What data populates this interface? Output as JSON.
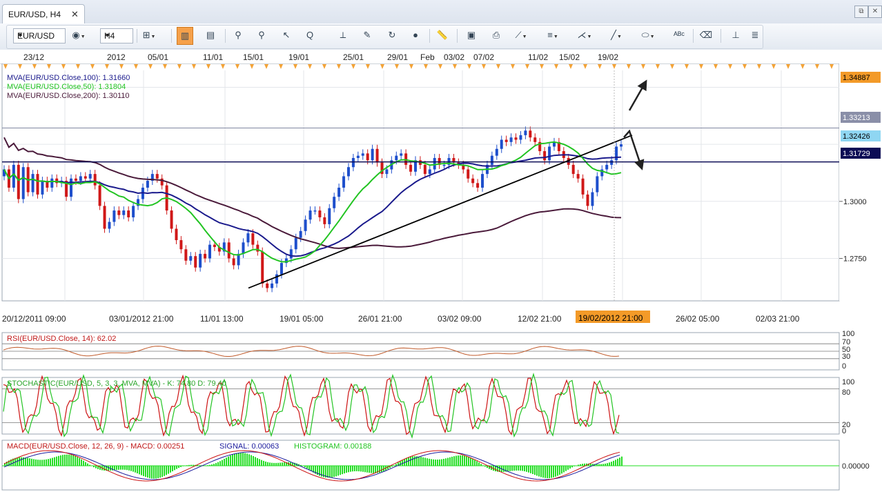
{
  "window": {
    "tab_title": "EUR/USD, H4",
    "tab_close": "✕",
    "restore_icon": "⧉",
    "close_icon": "✕"
  },
  "toolbar": {
    "symbol": "EUR/USD",
    "timeframe": "H4",
    "icons": [
      "chart-type-icon",
      "remove-icon",
      "candles-icon",
      "bars-icon",
      "crosshair-icon",
      "zoom-in-icon",
      "zoom-out-icon",
      "cursor-icon",
      "zoom-area-icon",
      "levels-icon",
      "edit-icon",
      "rotate-icon",
      "globe-icon",
      "ruler-icon",
      "image-icon",
      "print-icon",
      "trendline-tool-icon",
      "channel-icon",
      "fan-icon",
      "pencil-icon",
      "ellipse-icon",
      "text-icon",
      "eraser-icon",
      "hierarchy-icon",
      "menu-icon"
    ]
  },
  "top_dates": [
    "23/12",
    "2012",
    "05/01",
    "11/01",
    "15/01",
    "19/01",
    "25/01",
    "29/01",
    "Feb",
    "03/02",
    "07/02",
    "11/02",
    "15/02",
    "19/02"
  ],
  "chart_data": [
    {
      "type": "candlestick",
      "symbol": "EUR/USD",
      "timeframe": "H4",
      "indicators": [
        {
          "label": "MVA(EUR/USD.Close,100): 1.31660",
          "color": "#1a1a8c"
        },
        {
          "label": "MVA(EUR/USD.Close,50): 1.31804",
          "color": "#22c422"
        },
        {
          "label": "MVA(EUR/USD.Close,200): 1.30110",
          "color": "#4a1a3a"
        }
      ],
      "price_ticks": [
        "1.3000",
        "1.2750"
      ],
      "price_tags": [
        {
          "label": "1.34887",
          "bg": "#f39a28",
          "fg": "#000000"
        },
        {
          "label": "1.33213",
          "bg": "#8a8fa8",
          "fg": "#ffffff"
        },
        {
          "label": "1.32426",
          "bg": "#8fd6f2",
          "fg": "#000000"
        },
        {
          "label": "1.31729",
          "bg": "#0c0c55",
          "fg": "#ffffff"
        }
      ],
      "x_labels": [
        "20/12/2011 09:00",
        "03/01/2012 21:00",
        "11/01 13:00",
        "19/01 05:00",
        "26/01 21:00",
        "03/02 09:00",
        "12/02 21:00",
        "26/02 05:00",
        "02/03 21:00"
      ],
      "cursor_label": "19/02/2012 21:00",
      "ylim": [
        1.257,
        1.358
      ],
      "closes": [
        1.314,
        1.306,
        1.316,
        1.301,
        1.315,
        1.304,
        1.312,
        1.303,
        1.309,
        1.306,
        1.31,
        1.308,
        1.309,
        1.302,
        1.31,
        1.309,
        1.311,
        1.31,
        1.312,
        1.307,
        1.298,
        1.288,
        1.291,
        1.296,
        1.294,
        1.296,
        1.293,
        1.298,
        1.301,
        1.306,
        1.309,
        1.312,
        1.31,
        1.307,
        1.296,
        1.288,
        1.283,
        1.279,
        1.274,
        1.276,
        1.271,
        1.277,
        1.275,
        1.281,
        1.28,
        1.278,
        1.282,
        1.275,
        1.272,
        1.277,
        1.282,
        1.286,
        1.281,
        1.278,
        1.264,
        1.262,
        1.264,
        1.268,
        1.273,
        1.275,
        1.279,
        1.284,
        1.287,
        1.292,
        1.296,
        1.296,
        1.293,
        1.29,
        1.297,
        1.302,
        1.306,
        1.311,
        1.315,
        1.319,
        1.32,
        1.321,
        1.318,
        1.323,
        1.317,
        1.312,
        1.314,
        1.318,
        1.32,
        1.321,
        1.316,
        1.313,
        1.318,
        1.316,
        1.312,
        1.314,
        1.319,
        1.316,
        1.316,
        1.319,
        1.317,
        1.316,
        1.314,
        1.31,
        1.308,
        1.306,
        1.312,
        1.316,
        1.32,
        1.323,
        1.327,
        1.326,
        1.328,
        1.327,
        1.329,
        1.331,
        1.328,
        1.326,
        1.322,
        1.318,
        1.324,
        1.326,
        1.322,
        1.319,
        1.316,
        1.312,
        1.31,
        1.303,
        1.298,
        1.304,
        1.311,
        1.314,
        1.316,
        1.318,
        1.324,
        1.325
      ]
    },
    {
      "type": "line",
      "title": "RSI(EUR/USD.Close, 14): 62.02",
      "levels": [
        70,
        50,
        30
      ],
      "axis_labels": [
        "100",
        "70",
        "50",
        "30",
        "0"
      ],
      "ylim": [
        0,
        100
      ]
    },
    {
      "type": "line",
      "title": "STOCHASTIC(EUR/USD, 5, 3, 3, MVA, MVA) -  K: 74.80  D: 79.40",
      "series": [
        {
          "name": "K",
          "color": "#22c422"
        },
        {
          "name": "D",
          "color": "#cc1111"
        }
      ],
      "levels": [
        80,
        20
      ],
      "axis_labels": [
        "100",
        "80",
        "20",
        "0"
      ],
      "ylim": [
        0,
        100
      ]
    },
    {
      "type": "bar",
      "title": "MACD(EUR/USD.Close, 12, 26, 9) -  MACD: 0.00251  SIGNAL: 0.00063  HISTOGRAM: 0.00188",
      "title_parts": [
        "MACD(EUR/USD.Close, 12, 26, 9) -  MACD: 0.00251",
        "SIGNAL: 0.00063",
        "HISTOGRAM: 0.00188"
      ],
      "series": [
        {
          "name": "MACD",
          "color": "#cc1111"
        },
        {
          "name": "SIGNAL",
          "color": "#1a1a9c"
        },
        {
          "name": "HISTOGRAM",
          "color": "#22dd22"
        }
      ],
      "axis_labels": [
        "0.00000"
      ]
    }
  ]
}
